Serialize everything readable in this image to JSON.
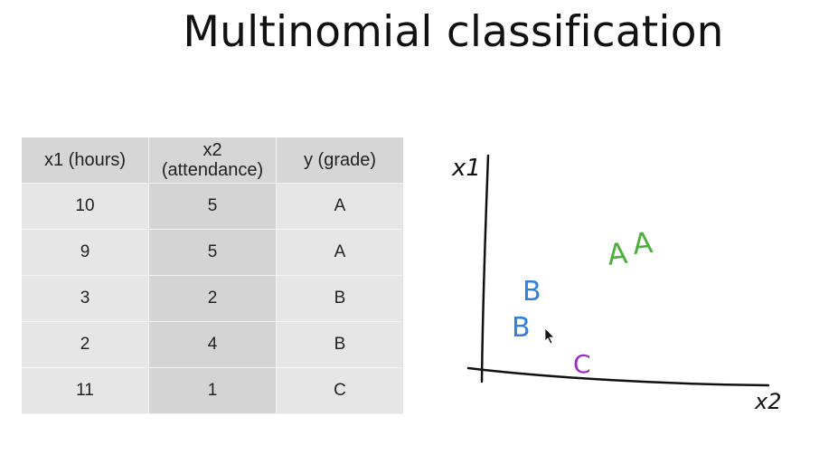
{
  "title": "Multinomial classification",
  "table": {
    "headers": [
      "x1 (hours)",
      "x2",
      "(attendance)",
      "y (grade)"
    ],
    "rows": [
      [
        "10",
        "5",
        "A"
      ],
      [
        "9",
        "5",
        "A"
      ],
      [
        "3",
        "2",
        "B"
      ],
      [
        "2",
        "4",
        "B"
      ],
      [
        "11",
        "1",
        "C"
      ]
    ]
  },
  "sketch": {
    "axis_y_label": "x1",
    "axis_x_label": "x2",
    "points": [
      {
        "label": "A",
        "color": "#4caf3a"
      },
      {
        "label": "A",
        "color": "#4caf3a"
      },
      {
        "label": "B",
        "color": "#2f7fdb"
      },
      {
        "label": "B",
        "color": "#2f7fdb"
      },
      {
        "label": "C",
        "color": "#9b2fc4"
      }
    ]
  }
}
